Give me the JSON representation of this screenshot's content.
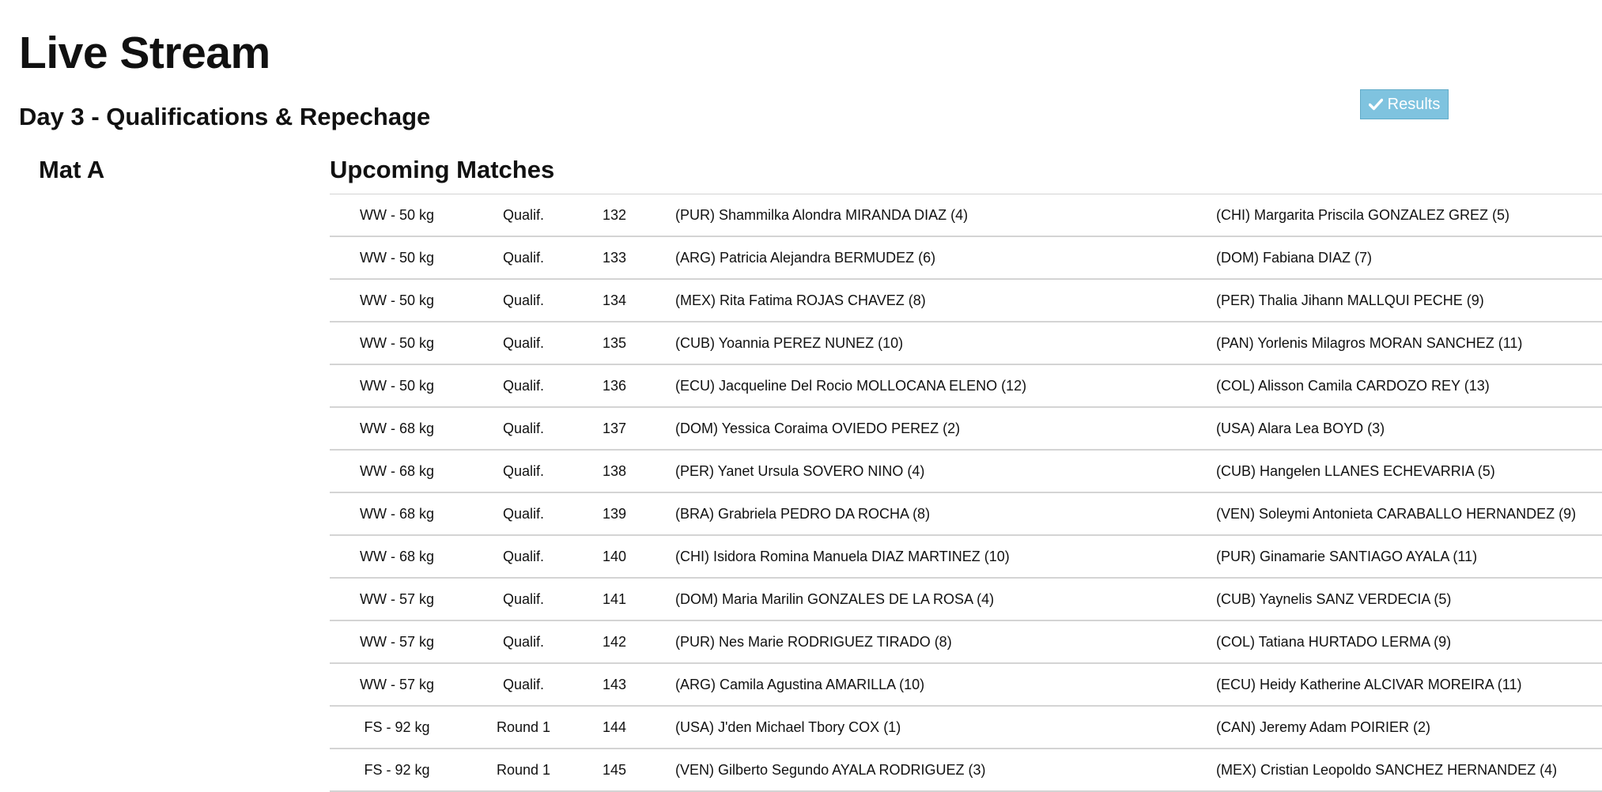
{
  "header": {
    "title": "Live Stream",
    "day_title": "Day 3 - Qualifications & Repechage",
    "results_button": {
      "label": "Results",
      "icon": "checkmark-icon",
      "color": "#7fc3df"
    }
  },
  "mat": {
    "title": "Mat A"
  },
  "upcoming": {
    "title": "Upcoming Matches",
    "matches": [
      {
        "weight": "WW - 50 kg",
        "round": "Qualif.",
        "number": "132",
        "red": "(PUR) Shammilka Alondra MIRANDA DIAZ (4)",
        "blue": "(CHI) Margarita Priscila GONZALEZ GREZ (5)"
      },
      {
        "weight": "WW - 50 kg",
        "round": "Qualif.",
        "number": "133",
        "red": "(ARG) Patricia Alejandra BERMUDEZ (6)",
        "blue": "(DOM) Fabiana DIAZ (7)"
      },
      {
        "weight": "WW - 50 kg",
        "round": "Qualif.",
        "number": "134",
        "red": "(MEX) Rita Fatima ROJAS CHAVEZ (8)",
        "blue": "(PER) Thalia Jihann MALLQUI PECHE (9)"
      },
      {
        "weight": "WW - 50 kg",
        "round": "Qualif.",
        "number": "135",
        "red": "(CUB) Yoannia PEREZ NUNEZ (10)",
        "blue": "(PAN) Yorlenis Milagros MORAN SANCHEZ (11)"
      },
      {
        "weight": "WW - 50 kg",
        "round": "Qualif.",
        "number": "136",
        "red": "(ECU) Jacqueline Del Rocio MOLLOCANA ELENO (12)",
        "blue": "(COL) Alisson Camila CARDOZO REY (13)"
      },
      {
        "weight": "WW - 68 kg",
        "round": "Qualif.",
        "number": "137",
        "red": "(DOM) Yessica Coraima OVIEDO PEREZ (2)",
        "blue": "(USA) Alara Lea BOYD (3)"
      },
      {
        "weight": "WW - 68 kg",
        "round": "Qualif.",
        "number": "138",
        "red": "(PER) Yanet Ursula SOVERO NINO (4)",
        "blue": "(CUB) Hangelen LLANES ECHEVARRIA (5)"
      },
      {
        "weight": "WW - 68 kg",
        "round": "Qualif.",
        "number": "139",
        "red": "(BRA) Grabriela PEDRO DA ROCHA (8)",
        "blue": "(VEN) Soleymi Antonieta CARABALLO HERNANDEZ (9)"
      },
      {
        "weight": "WW - 68 kg",
        "round": "Qualif.",
        "number": "140",
        "red": "(CHI) Isidora Romina Manuela DIAZ MARTINEZ (10)",
        "blue": "(PUR) Ginamarie SANTIAGO AYALA (11)"
      },
      {
        "weight": "WW - 57 kg",
        "round": "Qualif.",
        "number": "141",
        "red": "(DOM) Maria Marilin GONZALES DE LA ROSA (4)",
        "blue": "(CUB) Yaynelis SANZ VERDECIA (5)"
      },
      {
        "weight": "WW - 57 kg",
        "round": "Qualif.",
        "number": "142",
        "red": "(PUR) Nes Marie RODRIGUEZ TIRADO (8)",
        "blue": "(COL) Tatiana HURTADO LERMA (9)"
      },
      {
        "weight": "WW - 57 kg",
        "round": "Qualif.",
        "number": "143",
        "red": "(ARG) Camila Agustina AMARILLA (10)",
        "blue": "(ECU) Heidy Katherine ALCIVAR MOREIRA (11)"
      },
      {
        "weight": "FS - 92 kg",
        "round": "Round 1",
        "number": "144",
        "red": "(USA) J'den Michael Tbory COX (1)",
        "blue": "(CAN) Jeremy Adam POIRIER (2)"
      },
      {
        "weight": "FS - 92 kg",
        "round": "Round 1",
        "number": "145",
        "red": "(VEN) Gilberto Segundo AYALA RODRIGUEZ (3)",
        "blue": "(MEX) Cristian Leopoldo SANCHEZ HERNANDEZ (4)"
      }
    ]
  }
}
